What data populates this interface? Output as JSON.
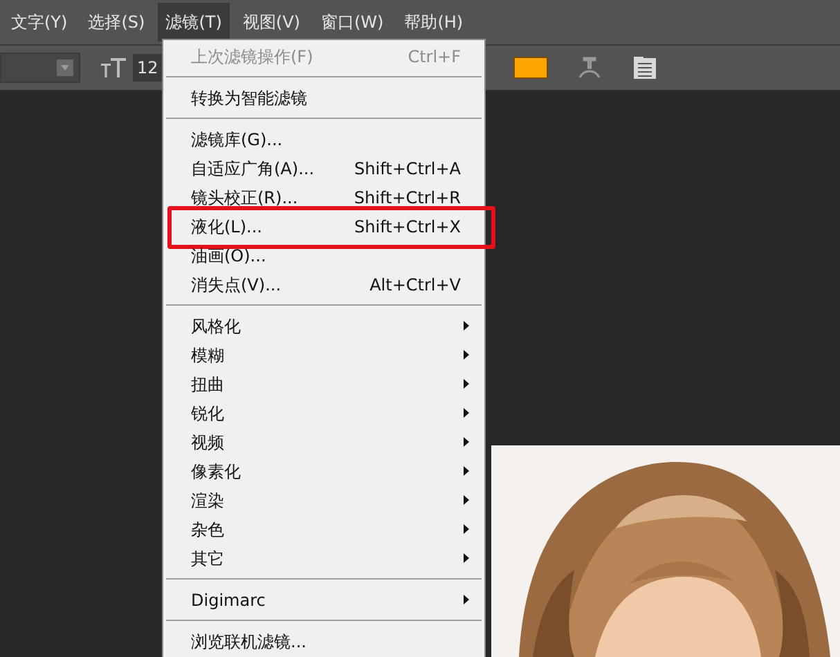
{
  "menubar": [
    {
      "label": "文字(Y)",
      "selected": false
    },
    {
      "label": "选择(S)",
      "selected": false
    },
    {
      "label": "滤镜(T)",
      "selected": true
    },
    {
      "label": "视图(V)",
      "selected": false
    },
    {
      "label": "窗口(W)",
      "selected": false
    },
    {
      "label": "帮助(H)",
      "selected": false
    }
  ],
  "toolbar": {
    "font_size": "12",
    "color_swatch": {
      "color": "#ffa500"
    }
  },
  "filter_menu": {
    "items": [
      {
        "kind": "command",
        "label": "上次滤镜操作(F)",
        "shortcut": "Ctrl+F",
        "disabled": true,
        "highlighted": false
      },
      {
        "kind": "separator"
      },
      {
        "kind": "command",
        "label": "转换为智能滤镜",
        "disabled": false,
        "highlighted": false
      },
      {
        "kind": "separator"
      },
      {
        "kind": "command",
        "label": "滤镜库(G)...",
        "disabled": false,
        "highlighted": false
      },
      {
        "kind": "command",
        "label": "自适应广角(A)...",
        "shortcut": "Shift+Ctrl+A",
        "disabled": false,
        "highlighted": false
      },
      {
        "kind": "command",
        "label": "镜头校正(R)...",
        "shortcut": "Shift+Ctrl+R",
        "disabled": false,
        "highlighted": false
      },
      {
        "kind": "command",
        "label": "液化(L)...",
        "shortcut": "Shift+Ctrl+X",
        "disabled": false,
        "highlighted": true
      },
      {
        "kind": "command",
        "label": "油画(O)...",
        "disabled": false,
        "highlighted": false
      },
      {
        "kind": "command",
        "label": "消失点(V)...",
        "shortcut": "Alt+Ctrl+V",
        "disabled": false,
        "highlighted": false
      },
      {
        "kind": "separator"
      },
      {
        "kind": "submenu",
        "label": "风格化"
      },
      {
        "kind": "submenu",
        "label": "模糊"
      },
      {
        "kind": "submenu",
        "label": "扭曲"
      },
      {
        "kind": "submenu",
        "label": "锐化"
      },
      {
        "kind": "submenu",
        "label": "视频"
      },
      {
        "kind": "submenu",
        "label": "像素化"
      },
      {
        "kind": "submenu",
        "label": "渲染"
      },
      {
        "kind": "submenu",
        "label": "杂色"
      },
      {
        "kind": "submenu",
        "label": "其它"
      },
      {
        "kind": "separator"
      },
      {
        "kind": "submenu",
        "label": "Digimarc"
      },
      {
        "kind": "separator"
      },
      {
        "kind": "command",
        "label": "浏览联机滤镜...",
        "disabled": false,
        "highlighted": false
      }
    ]
  }
}
